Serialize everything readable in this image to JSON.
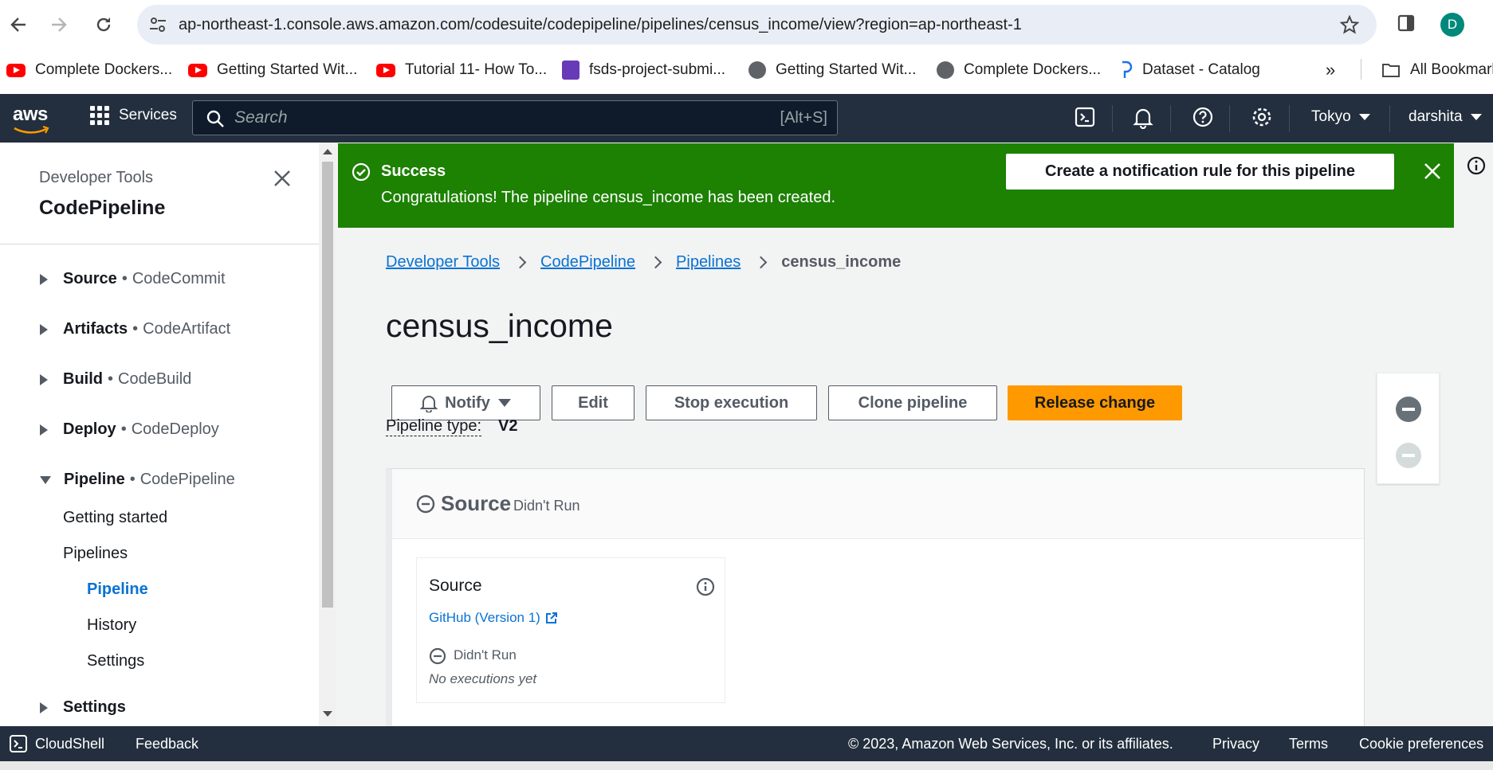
{
  "browser": {
    "url": "ap-northeast-1.console.aws.amazon.com/codesuite/codepipeline/pipelines/census_income/view?region=ap-northeast-1",
    "profile_initial": "D",
    "bookmarks": [
      {
        "label": "Complete Dockers...",
        "icon": "youtube-icon"
      },
      {
        "label": "Getting Started Wit...",
        "icon": "youtube-icon"
      },
      {
        "label": "Tutorial 11- How To...",
        "icon": "youtube-icon"
      },
      {
        "label": "fsds-project-submi...",
        "icon": "forms-icon"
      },
      {
        "label": "Getting Started Wit...",
        "icon": "globe-icon"
      },
      {
        "label": "Complete Dockers...",
        "icon": "globe-icon"
      },
      {
        "label": "Dataset - Catalog",
        "icon": "dataset-icon"
      }
    ],
    "more_bookmarks": "»",
    "all_bookmarks": "All Bookmarks"
  },
  "aws_header": {
    "logo": "aws",
    "services_label": "Services",
    "search_placeholder": "Search",
    "search_shortcut": "[Alt+S]",
    "region": "Tokyo",
    "user": "darshita"
  },
  "sidebar": {
    "eyebrow": "Developer Tools",
    "title": "CodePipeline",
    "sections": [
      {
        "name": "Source",
        "service": "CodeCommit",
        "expanded": false
      },
      {
        "name": "Artifacts",
        "service": "CodeArtifact",
        "expanded": false
      },
      {
        "name": "Build",
        "service": "CodeBuild",
        "expanded": false
      },
      {
        "name": "Deploy",
        "service": "CodeDeploy",
        "expanded": false
      },
      {
        "name": "Pipeline",
        "service": "CodePipeline",
        "expanded": true
      }
    ],
    "pipeline_items": [
      "Getting started",
      "Pipelines"
    ],
    "pipeline_sub_items": [
      "Pipeline",
      "History",
      "Settings"
    ],
    "settings_section": "Settings"
  },
  "flash": {
    "title": "Success",
    "message": "Congratulations! The pipeline census_income has been created.",
    "action_label": "Create a notification rule for this pipeline",
    "color": "#1d8102"
  },
  "breadcrumb": {
    "items": [
      "Developer Tools",
      "CodePipeline",
      "Pipelines"
    ],
    "current": "census_income"
  },
  "page": {
    "title": "census_income",
    "buttons": {
      "notify": "Notify",
      "edit": "Edit",
      "stop": "Stop execution",
      "clone": "Clone pipeline",
      "release": "Release change"
    },
    "pipeline_type_label": "Pipeline type:",
    "pipeline_type_value": "V2",
    "accent_color": "#ff9900"
  },
  "stage": {
    "name": "Source",
    "status": "Didn't Run",
    "action": {
      "title": "Source",
      "provider_link": "GitHub (Version 1)",
      "status": "Didn't Run",
      "note": "No executions yet"
    }
  },
  "footer": {
    "cloudshell": "CloudShell",
    "feedback": "Feedback",
    "copyright": "© 2023, Amazon Web Services, Inc. or its affiliates.",
    "links": [
      "Privacy",
      "Terms",
      "Cookie preferences"
    ]
  }
}
